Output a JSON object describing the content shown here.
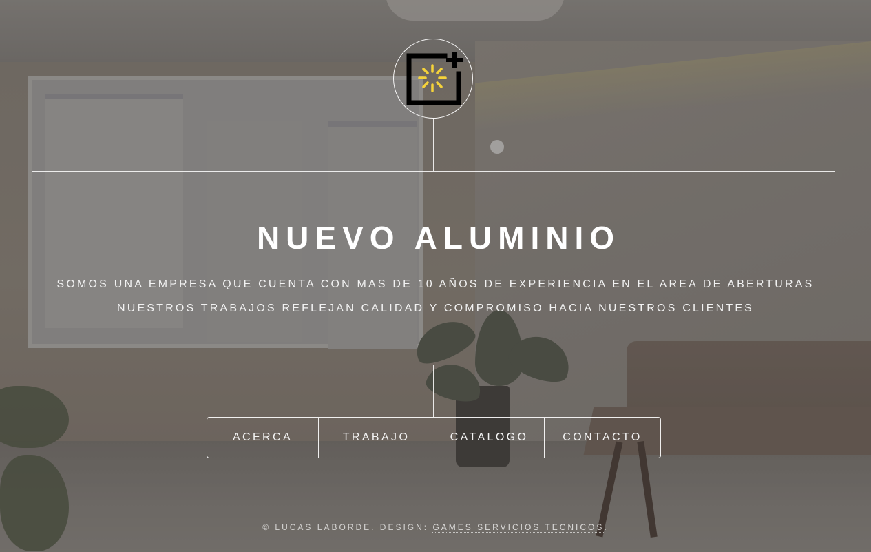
{
  "site": {
    "title": "NUEVO ALUMINIO",
    "logo_icon": "light-box-plus-icon",
    "logo_colors": {
      "frame": "#000000",
      "rays": "#f5d33a"
    }
  },
  "intro": {
    "line1": "SOMOS UNA EMPRESA QUE CUENTA CON MAS DE 10 AÑOS DE EXPERIENCIA EN EL AREA DE ABERTURAS",
    "line2": "NUESTROS TRABAJOS REFLEJAN CALIDAD Y COMPROMISO HACIA NUESTROS CLIENTES"
  },
  "nav": {
    "items": [
      {
        "label": "ACERCA"
      },
      {
        "label": "TRABAJO"
      },
      {
        "label": "CATALOGO"
      },
      {
        "label": "CONTACTO"
      }
    ]
  },
  "footer": {
    "prefix": "© LUCAS LABORDE. DESIGN: ",
    "link_text": "GAMES SERVICIOS TECNICOS",
    "suffix": "."
  },
  "colors": {
    "text": "#ffffff",
    "overlay": "rgba(70,62,58,0.30)"
  }
}
